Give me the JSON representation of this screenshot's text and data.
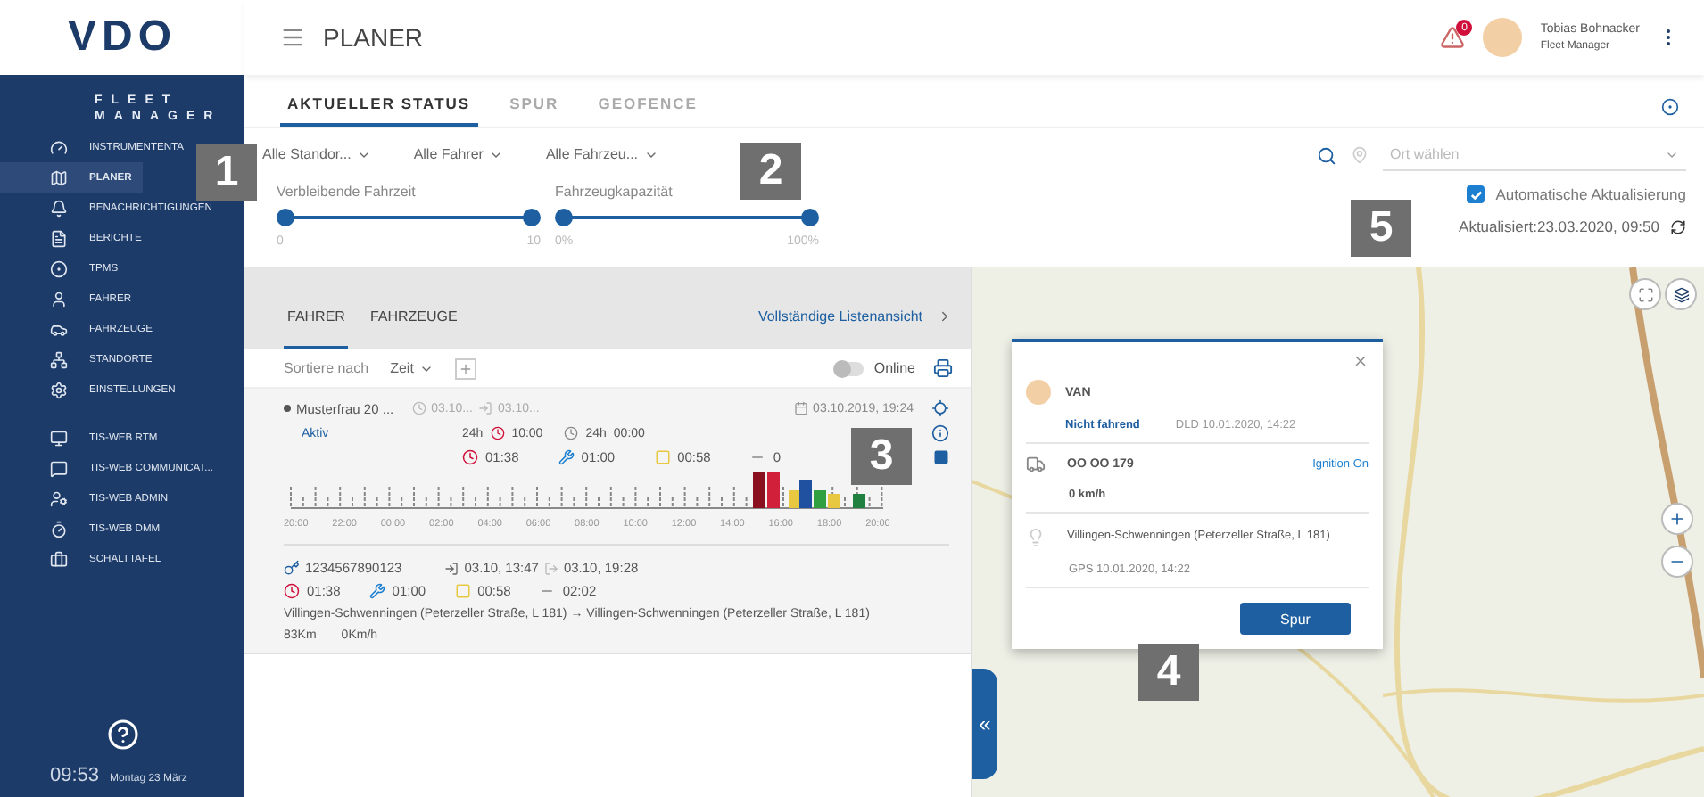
{
  "sidebar": {
    "logo": "VDO",
    "product": [
      "FLEET",
      "MANAGER"
    ],
    "items": [
      {
        "label": "INSTRUMENTENTA",
        "selected": false
      },
      {
        "label": "PLANER",
        "selected": true
      },
      {
        "label": "BENACHRICHTIGUNGEN",
        "selected": false
      },
      {
        "label": "BERICHTE",
        "selected": false
      },
      {
        "label": "TPMS",
        "selected": false
      },
      {
        "label": "FAHRER",
        "selected": false
      },
      {
        "label": "FAHRZEUGE",
        "selected": false
      },
      {
        "label": "STANDORTE",
        "selected": false
      },
      {
        "label": "EINSTELLUNGEN",
        "selected": false
      }
    ],
    "tools": [
      {
        "label": "TIS-WEB RTM",
        "selected": false
      },
      {
        "label": "TIS-WEB COMMUNICAT...",
        "selected": false
      },
      {
        "label": "TIS-WEB ADMIN",
        "selected": false
      },
      {
        "label": "TIS-WEB DMM",
        "selected": false
      },
      {
        "label": "SCHALTTAFEL",
        "selected": false
      }
    ],
    "clock": "09:53",
    "date": "Montag 23 März"
  },
  "header": {
    "title": "PLANER",
    "alert_count": "0",
    "user_name": "Tobias Bohnacker",
    "user_role": "Fleet Manager"
  },
  "tabs": [
    {
      "label": "AKTUELLER STATUS",
      "selected": true
    },
    {
      "label": "SPUR",
      "selected": false
    },
    {
      "label": "GEOFENCE",
      "selected": false
    }
  ],
  "filters": [
    "Alle Standor...",
    "Alle Fahrer",
    "Alle Fahrzeu..."
  ],
  "place_search": {
    "placeholder": "Ort wählen"
  },
  "sliders": [
    {
      "label": "Verbleibende Fahrzeit",
      "min": "0",
      "max": "10",
      "thumbs": [
        {
          "level": 0
        },
        {
          "level": 1
        }
      ]
    },
    {
      "label": "Fahrzeugkapazität",
      "min": "0%",
      "max": "100%",
      "thumbs": [
        {
          "level": 0
        },
        {
          "level": 1
        }
      ]
    }
  ],
  "auto_update": {
    "label": "Automatische Aktualisierung",
    "checked": true
  },
  "updated": "Aktualisiert:23.03.2020, 09:50",
  "list_panel": {
    "tabs": [
      {
        "label": "FAHRER",
        "selected": true
      },
      {
        "label": "FAHRZEUGE",
        "selected": false
      }
    ],
    "full_view_link": "Vollständige Listenansicht",
    "sort_label": "Sortiere nach",
    "sort_value": "Zeit",
    "online": {
      "label": "Online",
      "on": false
    },
    "driver": {
      "name": "Musterfrau 20 ...",
      "start": "03.10...",
      "end": "03.10...",
      "last_update": "03.10.2019, 19:24",
      "status": "Aktiv",
      "limits": [
        "24h",
        "10:00",
        "24h",
        "00:00"
      ],
      "times": [
        {
          "kind": "driving",
          "value": "01:38"
        },
        {
          "kind": "work",
          "value": "01:00"
        },
        {
          "kind": "available",
          "value": "00:58"
        },
        {
          "kind": "rest",
          "value": "0"
        }
      ],
      "timeline_labels": [
        "20:00",
        "22:00",
        "00:00",
        "02:00",
        "04:00",
        "06:00",
        "08:00",
        "10:00",
        "12:00",
        "14:00",
        "16:00",
        "18:00",
        "20:00"
      ]
    },
    "vehicle": {
      "id": "1234567890123",
      "start": "03.10, 13:47",
      "end": "03.10, 19:28",
      "times": [
        {
          "kind": "driving",
          "value": "01:38"
        },
        {
          "kind": "work",
          "value": "01:00"
        },
        {
          "kind": "available",
          "value": "00:58"
        },
        {
          "kind": "rest",
          "value": "02:02"
        }
      ],
      "from": "Villingen-Schwenningen (Peterzeller Straße, L 181)",
      "arrow": "→",
      "to": "Villingen-Schwenningen (Peterzeller Straße, L 181)",
      "distance": "83Km",
      "speed": "0Km/h"
    }
  },
  "map": {
    "collapse": "«",
    "popup": {
      "vehicle_type": "VAN",
      "state": "Nicht fahrend",
      "dld": "DLD 10.01.2020, 14:22",
      "plate": "OO OO 179",
      "ignition": "Ignition On",
      "speed": "0 km/h",
      "address": "Villingen-Schwenningen (Peterzeller Straße, L 181)",
      "gps": "GPS 10.01.2020, 14:22",
      "button": "Spur"
    }
  },
  "callouts": [
    "1",
    "2",
    "3",
    "4",
    "5"
  ]
}
